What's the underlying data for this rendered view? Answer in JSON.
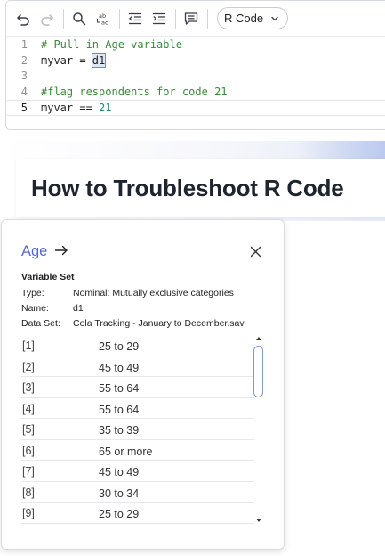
{
  "editor": {
    "toolbar": {
      "buttons": [
        {
          "name": "undo-button",
          "icon": "undo-icon"
        },
        {
          "name": "redo-button",
          "icon": "redo-icon"
        },
        {
          "name": "search-button",
          "icon": "search-icon"
        },
        {
          "name": "replace-button",
          "icon": "replace-icon"
        },
        {
          "name": "outdent-button",
          "icon": "outdent-icon"
        },
        {
          "name": "indent-button",
          "icon": "indent-icon"
        },
        {
          "name": "comment-button",
          "icon": "comment-icon"
        }
      ],
      "replace_icon_text_top": "ab",
      "replace_icon_text_bottom": "ac",
      "language": "R Code"
    },
    "lines": [
      {
        "number": "1",
        "text": "# Pull in Age variable"
      },
      {
        "number": "2",
        "prefix": "myvar = ",
        "highlight": "d1"
      },
      {
        "number": "3",
        "text": ""
      },
      {
        "number": "4",
        "text": "#flag respondents for code 21"
      },
      {
        "number": "5",
        "prefix": "myvar == ",
        "value": "21"
      }
    ]
  },
  "document": {
    "title": "How to Troubleshoot R Code"
  },
  "variable_popover": {
    "name": "Age",
    "section_heading": "Variable Set",
    "meta": [
      {
        "key": "Type:",
        "value": "Nominal: Mutually exclusive categories"
      },
      {
        "key": "Name:",
        "value": "d1"
      },
      {
        "key": "Data Set:",
        "value": "Cola Tracking - January to December.sav"
      }
    ],
    "values": [
      {
        "index": "[1]",
        "label": "25 to 29"
      },
      {
        "index": "[2]",
        "label": "45 to 49"
      },
      {
        "index": "[3]",
        "label": "55 to 64"
      },
      {
        "index": "[4]",
        "label": "55 to 64"
      },
      {
        "index": "[5]",
        "label": "35 to 39"
      },
      {
        "index": "[6]",
        "label": "65 or more"
      },
      {
        "index": "[7]",
        "label": "45 to 49"
      },
      {
        "index": "[8]",
        "label": "30 to 34"
      },
      {
        "index": "[9]",
        "label": "25 to 29"
      }
    ]
  },
  "colors": {
    "accent": "#5867d8",
    "comment": "#3a8a3a",
    "number": "#2b8a6e"
  }
}
